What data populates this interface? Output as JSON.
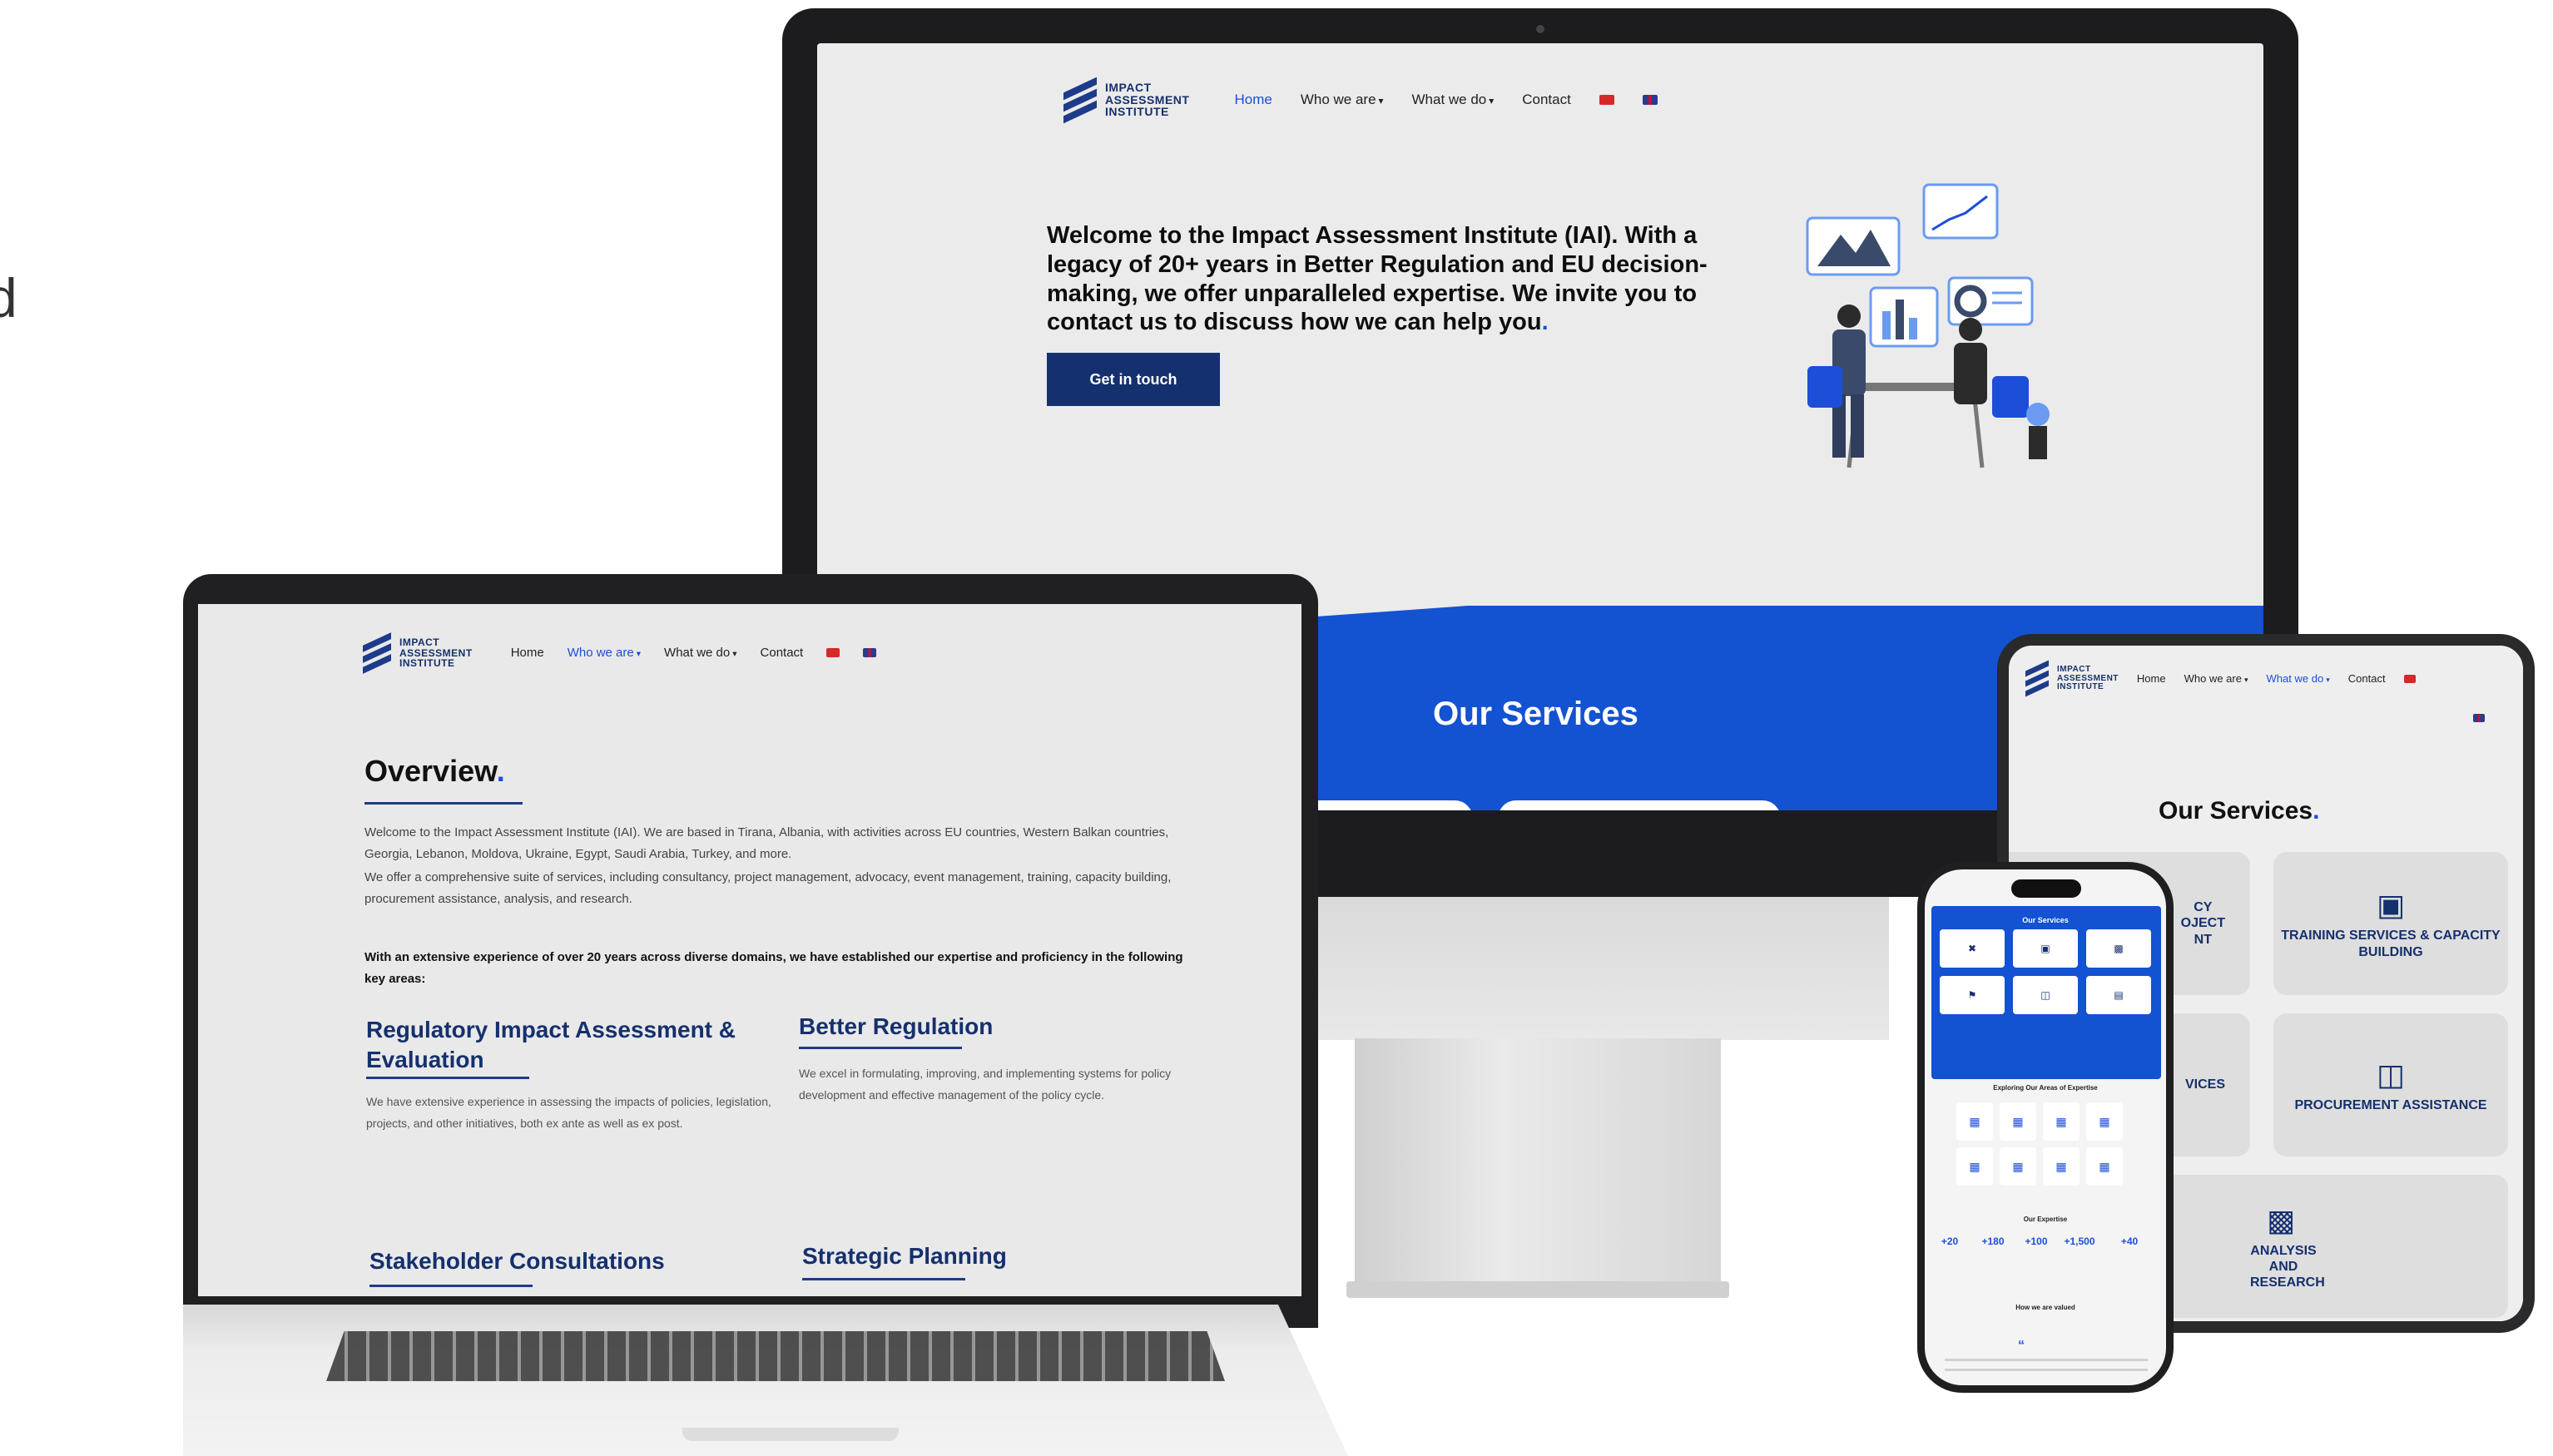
{
  "edge_text": "d",
  "brand": {
    "logo_lines": [
      "IMPACT",
      "ASSESSMENT",
      "INSTITUTE"
    ],
    "primary_color": "#15306e",
    "accent_color": "#1352d1"
  },
  "nav": {
    "home": "Home",
    "who": "Who we are",
    "what": "What we do",
    "contact": "Contact",
    "caret": "▾"
  },
  "monitor": {
    "hero_text": "Welcome to the Impact Assessment Institute (IAI). With a legacy of 20+ years in Better Regulation and EU decision-making, we offer unparalleled expertise. We invite you to contact us to discuss how we can help you",
    "hero_dot": ".",
    "cta": "Get in touch",
    "services_title": "Our Services"
  },
  "laptop": {
    "overview_title": "Overview",
    "overview_dot": ".",
    "para1": "Welcome to the Impact Assessment Institute (IAI). We are based in Tirana, Albania, with activities across EU countries, Western Balkan countries, Georgia, Lebanon, Moldova, Ukraine, Egypt, Saudi Arabia, Turkey, and more.",
    "para2": "We offer a comprehensive suite of services, including consultancy, project management, advocacy, event management, training, capacity building, procurement assistance, analysis, and research.",
    "bold": "With an extensive experience of over 20 years across diverse domains, we have established our expertise and proficiency in the following key areas:",
    "areas": [
      {
        "title": "Regulatory Impact Assessment & Evaluation",
        "text": "We have extensive experience in assessing the impacts of policies, legislation, projects, and other initiatives, both ex ante as well as ex post."
      },
      {
        "title": "Better Regulation",
        "text": "We excel in formulating, improving, and implementing systems for policy development and effective management of the policy cycle."
      },
      {
        "title": "Stakeholder Consultations",
        "text": ""
      },
      {
        "title": "Strategic Planning",
        "text": ""
      }
    ]
  },
  "tablet": {
    "title": "Our Services",
    "title_dot": ".",
    "cards": [
      {
        "label": "CY\nOJECT\nNT",
        "icon": ""
      },
      {
        "label": "TRAINING SERVICES & CAPACITY BUILDING",
        "icon": "presenter-icon"
      },
      {
        "label": "VICES",
        "icon": ""
      },
      {
        "label": "PROCUREMENT ASSISTANCE",
        "icon": "basket-icon"
      },
      {
        "label": "ANALYSIS AND RESEARCH",
        "icon": "bar-chart-icon"
      }
    ]
  },
  "phone": {
    "services_title": "Our Services",
    "expertise_title": "Exploring Our Areas of Expertise",
    "our_expertise": "Our Expertise",
    "valued": "How we are valued",
    "stats": [
      "+20",
      "+180",
      "+100",
      "+1,500",
      "+40"
    ],
    "quote_mark": "“"
  }
}
